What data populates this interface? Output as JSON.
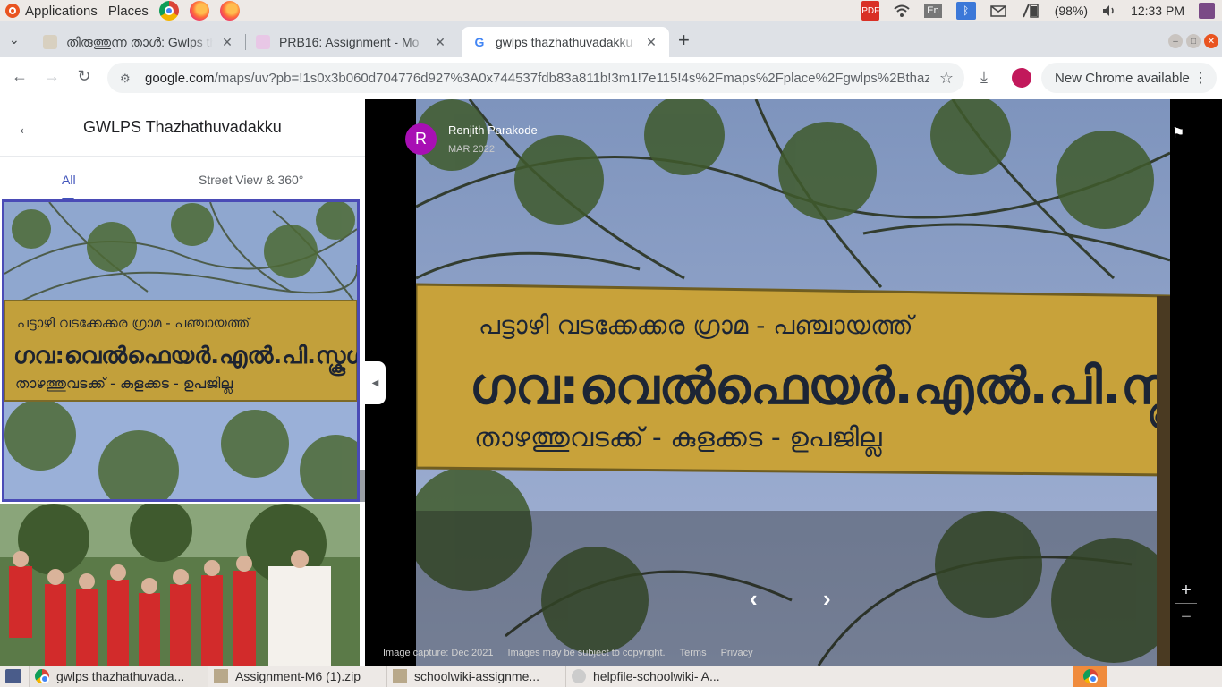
{
  "system_bar": {
    "applications_label": "Applications",
    "places_label": "Places",
    "battery": "(98%)",
    "clock": "12:33 PM",
    "keyboard_layout": "En",
    "pdf_badge": "PDF"
  },
  "tabs": [
    {
      "title": "തിരുത്തുന്ന താൾ: Gwlps tha",
      "icon": "wiki-icon"
    },
    {
      "title": "PRB16: Assignment - Mo",
      "icon": "moodle-icon"
    },
    {
      "title": "gwlps thazhathuvadakku",
      "icon": "google-icon",
      "active": true
    }
  ],
  "address_bar": {
    "url_host": "google.com",
    "url_path": "/maps/uv?pb=!1s0x3b060d704776d927%3A0x744537fdb83a811b!3m1!7e115!4s%2Fmaps%2Fplace%2Fgwlps%2Bthazhathuv...",
    "update_label": "New Chrome available"
  },
  "left_panel": {
    "title": "GWLPS Thazhathuvadakku",
    "tabs": [
      "All",
      "Street View & 360°"
    ],
    "sign": {
      "line1": "പട്ടാഴി വടക്കേക്കര ഗ്രാമ - പഞ്ചായത്ത്",
      "line2": "ഗവ:വെൽഫെയർ.എൽ.പി.സ്കൂൾ",
      "line3": "താഴത്തുവടക്ക് - കുളക്കട - ഉപജില്ല"
    }
  },
  "viewer": {
    "author_initial": "R",
    "author_name": "Renjith Parakode",
    "date": "MAR 2022",
    "footer": {
      "capture": "Image capture: Dec 2021",
      "copyright": "Images may be subject to copyright.",
      "terms": "Terms",
      "privacy": "Privacy"
    },
    "zoom_in": "+",
    "zoom_out": "−"
  },
  "taskbar": {
    "items": [
      "gwlps thazhathuvada...",
      "Assignment-M6 (1).zip",
      "schoolwiki-assignme...",
      "helpfile-schoolwiki- A..."
    ]
  },
  "colors": {
    "accent": "#4154bb",
    "sign_yellow": "#c9a33a",
    "avatar": "#a80fb4"
  }
}
